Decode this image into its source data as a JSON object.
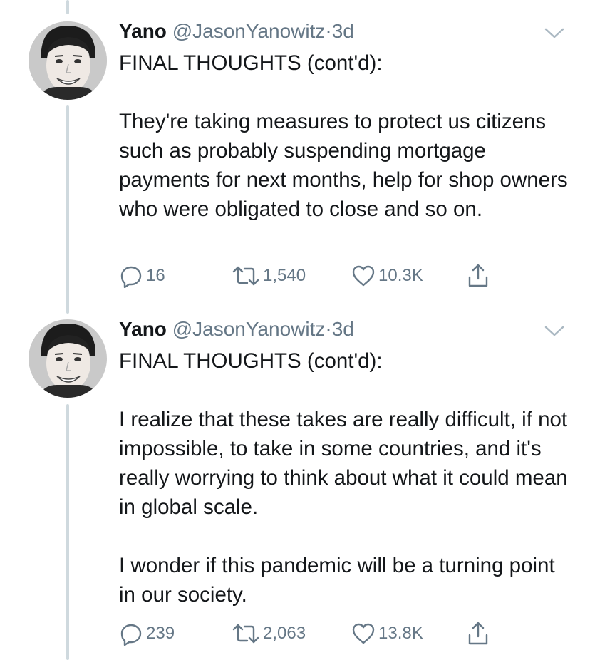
{
  "tweets": [
    {
      "author_name": "Yano",
      "handle": "@JasonYanowitz",
      "separator": "·",
      "time": "3d",
      "paragraphs": [
        "FINAL THOUGHTS (cont'd):",
        "They're taking measures to protect us citizens such as probably suspending mortgage payments for next months, help for shop owners who were obligated to close and so on."
      ],
      "replies": "16",
      "retweets": "1,540",
      "likes": "10.3K"
    },
    {
      "author_name": "Yano",
      "handle": "@JasonYanowitz",
      "separator": "·",
      "time": "3d",
      "paragraphs": [
        "FINAL THOUGHTS (cont'd):",
        "I realize that these takes are really difficult, if not impossible, to take in some countries, and it's really worrying to think about what it could mean in global scale.",
        "I wonder if this pandemic will be a turning point in our society."
      ],
      "replies": "239",
      "retweets": "2,063",
      "likes": "13.8K"
    }
  ],
  "icons": {
    "reply": "reply-icon",
    "retweet": "retweet-icon",
    "like": "heart-icon",
    "share": "share-icon",
    "menu": "chevron-down-icon"
  },
  "colors": {
    "text": "#14171a",
    "secondary": "#657786",
    "thread_line": "#cfd9de"
  }
}
